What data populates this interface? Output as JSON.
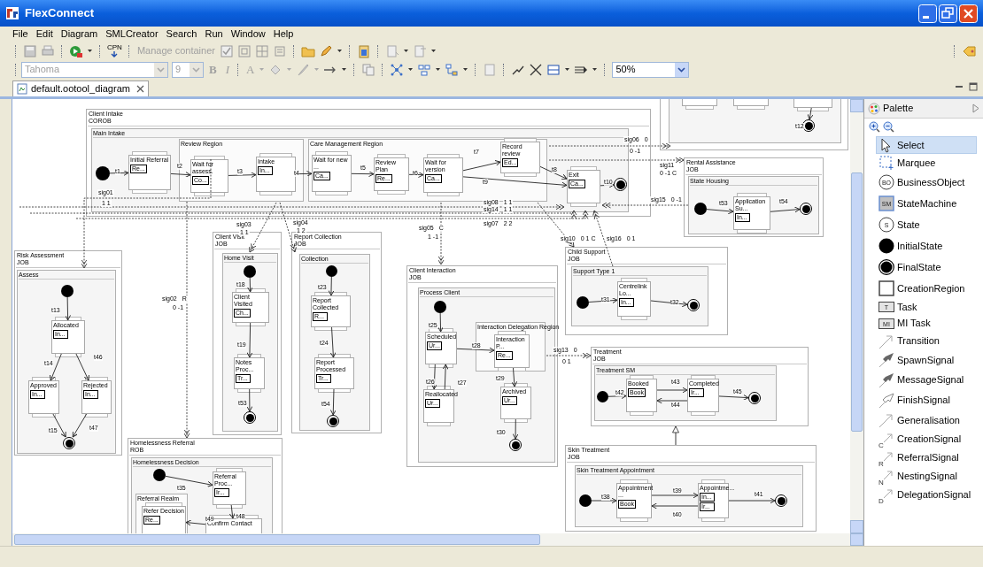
{
  "window": {
    "title": "FlexConnect"
  },
  "menu": [
    "File",
    "Edit",
    "Diagram",
    "SMLCreator",
    "Search",
    "Run",
    "Window",
    "Help"
  ],
  "toolbar": {
    "cpn": "CPN",
    "manage_container": {
      "label": "Manage container",
      "disabled": true
    },
    "font": {
      "value": "Tahoma",
      "disabled": true
    },
    "font_size": {
      "value": "9",
      "disabled": true
    },
    "bold": "B",
    "italic": "I",
    "font_color": "A",
    "zoom": "50%"
  },
  "editor_tab": {
    "title": "default.ootool_diagram"
  },
  "diagram": {
    "machines": [
      {
        "title": "Client Intake",
        "subtitle": "COROB",
        "region": "Main Intake"
      },
      {
        "clipped": true
      },
      {
        "title": "Rental Assistance",
        "subtitle": "JOB",
        "region": "State Housing"
      },
      {
        "title": "Risk Assessment",
        "subtitle": "JOB",
        "region": "Assess"
      },
      {
        "title": "Client Visit",
        "subtitle": "JOB",
        "region": "Home Visit"
      },
      {
        "title": "Report Collection",
        "subtitle": "JOB",
        "region": "Collection"
      },
      {
        "title": "Client Interaction",
        "subtitle": "JOB",
        "region": "Process Client"
      },
      {
        "title": "Child Support",
        "subtitle": "JOB",
        "region": "Support Type 1"
      },
      {
        "title": "Treatment",
        "subtitle": "JOB",
        "region": "Treatment SM"
      },
      {
        "title": "Skin Treatment",
        "subtitle": "JOB",
        "region": "Skin Treatment Appointment"
      },
      {
        "title": "Homelessness Referral",
        "subtitle": "ROB",
        "region": "Homelessness Decision"
      }
    ],
    "regions": [
      {
        "title": "Review Region"
      },
      {
        "title": "Care Management Region"
      },
      {
        "title": "Interaction Delegation Region"
      },
      {
        "title": "Referral Realm"
      }
    ],
    "nodes": [
      {
        "kind": "initial"
      },
      {
        "kind": "state",
        "label": "Initial Referral",
        "tasks": [
          "Re..."
        ]
      },
      {
        "kind": "state",
        "label": "Wait for assess.",
        "tasks": [
          "Co..."
        ]
      },
      {
        "kind": "state",
        "label": "Intake",
        "tasks": [
          "In..."
        ]
      },
      {
        "kind": "state",
        "label": "Wait for new ...",
        "tasks": [
          "Ca..."
        ]
      },
      {
        "kind": "state",
        "label": "Review Plan",
        "tasks": [
          "Re..."
        ]
      },
      {
        "kind": "state",
        "label": "Wait for version",
        "tasks": [
          "Ca..."
        ]
      },
      {
        "kind": "state",
        "label": "Record review",
        "tasks": [
          "Ed..."
        ]
      },
      {
        "kind": "state",
        "label": "Exit",
        "tasks": [
          "Ca..."
        ]
      },
      {
        "kind": "final"
      },
      {
        "kind": "state"
      },
      {
        "kind": "state"
      },
      {
        "kind": "state"
      },
      {
        "kind": "final"
      },
      {
        "kind": "initial"
      },
      {
        "kind": "state",
        "label": "Application Su...",
        "tasks": [
          "In..."
        ]
      },
      {
        "kind": "final"
      },
      {
        "kind": "initial"
      },
      {
        "kind": "state",
        "label": "Allocated",
        "tasks": [
          "In..."
        ]
      },
      {
        "kind": "state",
        "label": "Approved",
        "tasks": [
          "In..."
        ]
      },
      {
        "kind": "state",
        "label": "Rejected",
        "tasks": [
          "In..."
        ]
      },
      {
        "kind": "final"
      },
      {
        "kind": "initial"
      },
      {
        "kind": "state",
        "label": "Client Visited",
        "tasks": [
          "Ch..."
        ]
      },
      {
        "kind": "state",
        "label": "Notes Proc...",
        "tasks": [
          "Tr..."
        ]
      },
      {
        "kind": "final"
      },
      {
        "kind": "initial"
      },
      {
        "kind": "state",
        "label": "Report Collected",
        "tasks": [
          "R..."
        ]
      },
      {
        "kind": "state",
        "label": "Report Processed",
        "tasks": [
          "Tr..."
        ]
      },
      {
        "kind": "final"
      },
      {
        "kind": "initial"
      },
      {
        "kind": "state",
        "label": "Scheduled",
        "tasks": [
          "Ur..."
        ]
      },
      {
        "kind": "state",
        "label": "Reallocated",
        "tasks": [
          "Ur..."
        ]
      },
      {
        "kind": "state",
        "label": "Interaction P...",
        "tasks": [
          "Re..."
        ]
      },
      {
        "kind": "state",
        "label": "Archived",
        "tasks": [
          "Ur..."
        ]
      },
      {
        "kind": "final"
      },
      {
        "kind": "initial"
      },
      {
        "kind": "state",
        "label": "Centrelink Lo...",
        "tasks": [
          "In..."
        ]
      },
      {
        "kind": "final"
      },
      {
        "kind": "initial"
      },
      {
        "kind": "state",
        "label": "Booked",
        "tasks": [
          "Book"
        ]
      },
      {
        "kind": "state",
        "label": "Completed",
        "tasks": [
          "Ir..."
        ]
      },
      {
        "kind": "final"
      },
      {
        "kind": "initial"
      },
      {
        "kind": "state",
        "label": "Appointment ...",
        "tasks": [
          "Book"
        ]
      },
      {
        "kind": "state",
        "label": "Appointme...",
        "tasks": [
          "In...",
          "Ir..."
        ]
      },
      {
        "kind": "final"
      },
      {
        "kind": "initial"
      },
      {
        "kind": "state",
        "label": "Referral Proc...",
        "tasks": [
          "Ir..."
        ]
      },
      {
        "kind": "state",
        "label": "Refer Decision",
        "tasks": [
          "Re..."
        ]
      },
      {
        "kind": "state",
        "label": "Confirm Contact"
      }
    ],
    "transitions": [
      {
        "label": "t1"
      },
      {
        "label": "t2"
      },
      {
        "label": "t3"
      },
      {
        "label": "t4"
      },
      {
        "label": "t5"
      },
      {
        "label": "t6"
      },
      {
        "label": "t7"
      },
      {
        "label": "t9"
      },
      {
        "label": "t8"
      },
      {
        "label": "t10"
      },
      {
        "label": "t12"
      },
      {
        "label": "t53"
      },
      {
        "label": "t54"
      },
      {
        "label": "t13"
      },
      {
        "label": "t14"
      },
      {
        "label": "t46"
      },
      {
        "label": "t15"
      },
      {
        "label": "t47"
      },
      {
        "label": "t18"
      },
      {
        "label": "t19"
      },
      {
        "label": "t53"
      },
      {
        "label": "t23"
      },
      {
        "label": "t24"
      },
      {
        "label": "t54"
      },
      {
        "label": "t25"
      },
      {
        "label": "t26"
      },
      {
        "label": "t27"
      },
      {
        "label": "t28"
      },
      {
        "label": "t29"
      },
      {
        "label": "t30"
      },
      {
        "label": "t31"
      },
      {
        "label": "t32"
      },
      {
        "label": "t42"
      },
      {
        "label": "t43"
      },
      {
        "label": "t44"
      },
      {
        "label": "t45"
      },
      {
        "label": "t38"
      },
      {
        "label": "t39"
      },
      {
        "label": "t40"
      },
      {
        "label": "t41"
      },
      {
        "label": "t35"
      },
      {
        "label": "t48"
      },
      {
        "label": "t49"
      }
    ],
    "signals": [
      {
        "labels": [
          "sig01",
          "1 1"
        ]
      },
      {
        "labels": [
          "sig02",
          "R",
          "0 -1"
        ]
      },
      {
        "labels": [
          "sig03",
          "1 1"
        ]
      },
      {
        "labels": [
          "sig04",
          "1 2"
        ]
      },
      {
        "labels": [
          "sig05",
          "C",
          "1 -1"
        ]
      },
      {
        "labels": [
          "sig06",
          "0",
          "0 -1"
        ]
      },
      {
        "labels": [
          "sig11",
          "0 -1 C"
        ]
      },
      {
        "labels": [
          "sig08",
          "1 1"
        ]
      },
      {
        "labels": [
          "sig14",
          "1 1"
        ]
      },
      {
        "labels": [
          "sig07",
          "2 2"
        ]
      },
      {
        "labels": [
          "sig15",
          "0 -1"
        ]
      },
      {
        "labels": [
          "sig10",
          "0 1 C"
        ]
      },
      {
        "labels": [
          "sig16",
          "0 1"
        ]
      },
      {
        "labels": [
          "sig13",
          "0",
          "0 1"
        ]
      }
    ]
  },
  "palette": {
    "title": "Palette",
    "items": [
      {
        "label": "Select",
        "kind": "select",
        "selected": true
      },
      {
        "label": "Marquee",
        "kind": "marquee",
        "selected": false
      },
      {
        "label": "BusinessObject",
        "kind": "circle-badge",
        "badge": "BO",
        "selected": false
      },
      {
        "label": "StateMachine",
        "kind": "square-badge",
        "badge": "SM",
        "selected": false
      },
      {
        "label": "State",
        "kind": "circle-badge",
        "badge": "S",
        "selected": false
      },
      {
        "label": "InitialState",
        "kind": "initial",
        "selected": false
      },
      {
        "label": "FinalState",
        "kind": "final",
        "selected": false
      },
      {
        "label": "CreationRegion",
        "kind": "region",
        "selected": false
      },
      {
        "label": "Task",
        "kind": "task",
        "badge": "T",
        "selected": false
      },
      {
        "label": "MI Task",
        "kind": "task",
        "badge": "MI",
        "selected": false
      },
      {
        "label": "Transition",
        "kind": "arrow",
        "selected": false
      },
      {
        "label": "SpawnSignal",
        "kind": "filled-arrow",
        "selected": false
      },
      {
        "label": "MessageSignal",
        "kind": "filled-arrow",
        "selected": false
      },
      {
        "label": "FinishSignal",
        "kind": "hollow-arrow",
        "selected": false
      },
      {
        "label": "Generalisation",
        "kind": "arrow",
        "selected": false
      },
      {
        "label": "CreationSignal",
        "kind": "letter-arrow",
        "badge": "C",
        "selected": false
      },
      {
        "label": "ReferralSignal",
        "kind": "letter-arrow",
        "badge": "R",
        "selected": false
      },
      {
        "label": "NestingSignal",
        "kind": "letter-arrow",
        "badge": "N",
        "selected": false
      },
      {
        "label": "DelegationSignal",
        "kind": "letter-arrow",
        "badge": "D",
        "selected": false
      }
    ]
  }
}
